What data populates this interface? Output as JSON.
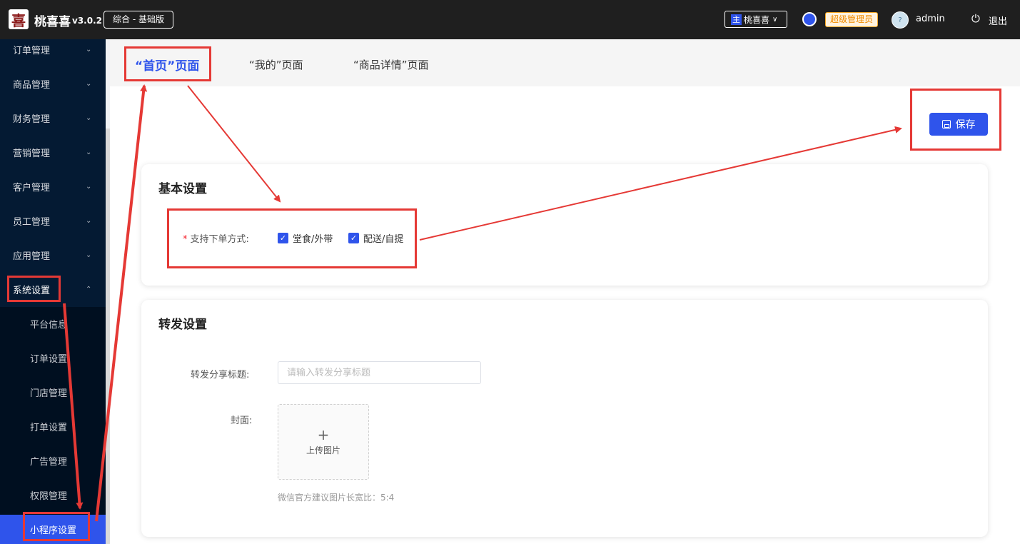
{
  "header": {
    "logo_char": "喜",
    "brand": "桃喜喜",
    "version": "v3.0.2",
    "edition": "综合 - 基础版",
    "store_badge": "主",
    "store_name": "桃喜喜",
    "role": "超级管理员",
    "avatar_text": "?",
    "username": "admin",
    "logout_label": "退出"
  },
  "sidebar": {
    "items": [
      {
        "label": "订单管理"
      },
      {
        "label": "商品管理"
      },
      {
        "label": "财务管理"
      },
      {
        "label": "营销管理"
      },
      {
        "label": "客户管理"
      },
      {
        "label": "员工管理"
      },
      {
        "label": "应用管理"
      },
      {
        "label": "系统设置"
      }
    ],
    "subitems": [
      {
        "label": "平台信息"
      },
      {
        "label": "订单设置"
      },
      {
        "label": "门店管理"
      },
      {
        "label": "打单设置"
      },
      {
        "label": "广告管理"
      },
      {
        "label": "权限管理"
      },
      {
        "label": "小程序设置"
      }
    ]
  },
  "tabs": [
    {
      "label": "“首页”页面"
    },
    {
      "label": "“我的”页面"
    },
    {
      "label": "“商品详情”页面"
    }
  ],
  "toolbar": {
    "save_label": "保存"
  },
  "basic": {
    "title": "基本设置",
    "order_modes_label": "支持下单方式:",
    "modes": [
      "堂食/外带",
      "配送/自提"
    ]
  },
  "share": {
    "title": "转发设置",
    "title_label": "转发分享标题:",
    "title_placeholder": "请输入转发分享标题",
    "cover_label": "封面:",
    "upload_label": "上传图片",
    "hint": "微信官方建议图片长宽比：5:4"
  },
  "colors": {
    "accent": "#2f54eb",
    "annotation": "#e53935",
    "sidebar": "#041a33"
  }
}
